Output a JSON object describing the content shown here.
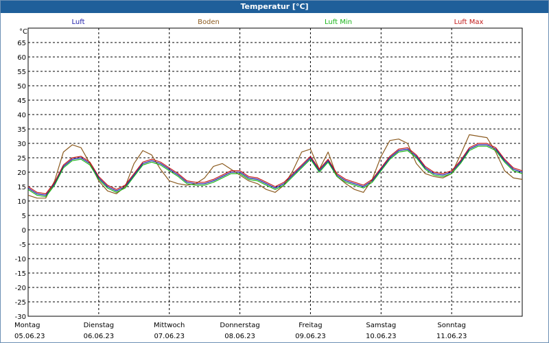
{
  "window": {
    "title": "Temperatur [°C]"
  },
  "chart_data": {
    "type": "line",
    "title": "Temperatur [°C]",
    "ylabel": "°C",
    "ylim": [
      -30,
      70
    ],
    "yticks": [
      -30,
      -25,
      -20,
      -15,
      -10,
      -5,
      0,
      5,
      10,
      15,
      20,
      25,
      30,
      35,
      40,
      45,
      50,
      55,
      60,
      65
    ],
    "grid": true,
    "legend_position": "top",
    "day_labels": [
      {
        "day": "Montag",
        "date": "05.06.23"
      },
      {
        "day": "Dienstag",
        "date": "06.06.23"
      },
      {
        "day": "Mittwoch",
        "date": "07.06.23"
      },
      {
        "day": "Donnerstag",
        "date": "08.06.23"
      },
      {
        "day": "Freitag",
        "date": "09.06.23"
      },
      {
        "day": "Samstag",
        "date": "10.06.23"
      },
      {
        "day": "Sonntag",
        "date": "11.06.23"
      }
    ],
    "x_unit": "hours since 05.06.23 00:00",
    "xlim": [
      0,
      168
    ],
    "series": [
      {
        "name": "Luft",
        "color": "#1a1aa8",
        "x": [
          0,
          3,
          6,
          9,
          12,
          15,
          18,
          21,
          24,
          27,
          30,
          33,
          36,
          39,
          42,
          45,
          48,
          51,
          54,
          57,
          60,
          63,
          66,
          69,
          72,
          75,
          78,
          81,
          84,
          87,
          90,
          93,
          96,
          99,
          102,
          105,
          108,
          111,
          114,
          117,
          120,
          123,
          126,
          129,
          132,
          135,
          138,
          141,
          144,
          147,
          150,
          153,
          156,
          159,
          162,
          165,
          168
        ],
        "values": [
          14.5,
          12.5,
          12,
          16,
          22,
          24.5,
          25,
          23,
          18,
          15,
          13.5,
          15,
          19,
          23,
          24,
          23,
          21,
          19,
          16.5,
          16,
          16,
          17,
          18.5,
          20,
          20,
          18,
          17.5,
          16,
          14.5,
          16,
          19,
          22,
          25,
          20.5,
          24,
          19,
          17,
          16,
          15,
          17,
          21,
          25,
          27.5,
          28,
          25.5,
          21.5,
          19.5,
          19,
          20,
          23.5,
          28,
          29.5,
          29.5,
          28,
          24,
          21,
          20
        ]
      },
      {
        "name": "Boden",
        "color": "#8b5a1e",
        "x": [
          0,
          3,
          6,
          9,
          12,
          15,
          18,
          21,
          24,
          27,
          30,
          33,
          36,
          39,
          42,
          45,
          48,
          51,
          54,
          57,
          60,
          63,
          66,
          69,
          72,
          75,
          78,
          81,
          84,
          87,
          90,
          93,
          96,
          99,
          102,
          105,
          108,
          111,
          114,
          117,
          120,
          123,
          126,
          129,
          132,
          135,
          138,
          141,
          144,
          147,
          150,
          153,
          156,
          159,
          162,
          165,
          168
        ],
        "values": [
          12,
          11,
          11,
          17,
          27,
          29.5,
          28.5,
          23,
          17,
          13.5,
          12.5,
          15,
          23,
          27.5,
          26,
          21,
          17,
          16,
          15.5,
          16,
          18,
          22,
          23,
          21,
          19,
          17,
          16,
          14,
          13,
          15.5,
          20.5,
          27,
          28,
          21,
          27,
          18.5,
          16,
          14,
          13,
          17.5,
          25.5,
          31,
          31.5,
          30,
          23,
          19.5,
          18.5,
          18,
          19.5,
          26,
          33,
          32.5,
          32,
          27,
          20.5,
          18,
          17.5
        ]
      },
      {
        "name": "Luft Min",
        "color": "#19b419",
        "x": [
          0,
          3,
          6,
          9,
          12,
          15,
          18,
          21,
          24,
          27,
          30,
          33,
          36,
          39,
          42,
          45,
          48,
          51,
          54,
          57,
          60,
          63,
          66,
          69,
          72,
          75,
          78,
          81,
          84,
          87,
          90,
          93,
          96,
          99,
          102,
          105,
          108,
          111,
          114,
          117,
          120,
          123,
          126,
          129,
          132,
          135,
          138,
          141,
          144,
          147,
          150,
          153,
          156,
          159,
          162,
          165,
          168
        ],
        "values": [
          14,
          12,
          11.5,
          15.5,
          21.5,
          24,
          24.5,
          22.5,
          17.5,
          14.5,
          13,
          14.5,
          18.5,
          22.5,
          23.5,
          22.5,
          20.5,
          18.5,
          16,
          15.5,
          15.5,
          16.5,
          18,
          19.5,
          19.5,
          17.5,
          17,
          15.5,
          14,
          15.5,
          18.5,
          21.5,
          24.5,
          20,
          23.5,
          18.5,
          16.5,
          15.5,
          14.5,
          16.5,
          20.5,
          24.5,
          27,
          27.5,
          25,
          21,
          19,
          18.5,
          19.5,
          23,
          27.5,
          29,
          29,
          27.5,
          23.5,
          20.5,
          19.5
        ]
      },
      {
        "name": "Luft Max",
        "color": "#c01818",
        "x": [
          0,
          3,
          6,
          9,
          12,
          15,
          18,
          21,
          24,
          27,
          30,
          33,
          36,
          39,
          42,
          45,
          48,
          51,
          54,
          57,
          60,
          63,
          66,
          69,
          72,
          75,
          78,
          81,
          84,
          87,
          90,
          93,
          96,
          99,
          102,
          105,
          108,
          111,
          114,
          117,
          120,
          123,
          126,
          129,
          132,
          135,
          138,
          141,
          144,
          147,
          150,
          153,
          156,
          159,
          162,
          165,
          168
        ],
        "values": [
          15,
          13,
          12.5,
          16.5,
          22.5,
          25,
          25.5,
          23.5,
          18.5,
          15.5,
          14,
          15.5,
          19.5,
          23.5,
          24.5,
          23.5,
          21.5,
          19.5,
          17,
          16.5,
          16.5,
          17.5,
          19,
          20.5,
          20.5,
          18.5,
          18,
          16.5,
          15,
          16.5,
          19.5,
          22.5,
          25.5,
          21,
          24.5,
          19.5,
          17.5,
          16.5,
          15.5,
          17.5,
          21.5,
          25.5,
          28,
          28.5,
          26,
          22,
          20,
          19.5,
          20.5,
          24,
          28.5,
          30,
          30,
          28.5,
          24.5,
          21.5,
          20.5
        ]
      }
    ]
  }
}
